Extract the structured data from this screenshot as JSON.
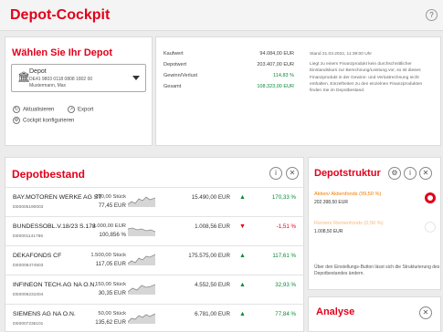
{
  "header": {
    "title": "Depot-Cockpit",
    "help_label": "?"
  },
  "selector": {
    "heading": "Wählen Sie Ihr Depot",
    "depot_name": "Depot",
    "depot_number": "DE41 9803 0118 0808 1802 00",
    "depot_owner": "Mustermann, Max",
    "actions": [
      {
        "label": "Aktualisieren",
        "icon": "refresh-icon",
        "glyph": "↻"
      },
      {
        "label": "Export",
        "icon": "export-icon",
        "glyph": "↗"
      },
      {
        "label": "Cockpit konfigurieren",
        "icon": "gear-icon",
        "glyph": "⚙"
      }
    ]
  },
  "summary": {
    "rows": [
      {
        "label": "Kaufwert",
        "value": "94.084,00 EUR"
      },
      {
        "label": "Depotwert",
        "value": "203.407,00 EUR"
      },
      {
        "label": "Gewinn/Verlust",
        "value": "114,83 %"
      },
      {
        "label": "Gesamt",
        "value": "108.323,00 EUR"
      }
    ],
    "info_date": "Stand 21.03.2022, 11:39:00 Uhr",
    "info_text": "Liegt zu einem Finanzprodukt kein durchschnittlicher Einstandskurs zur Berechnung/Leistung vor, so ist dieses Finanzprodukt in der Gewinn- und Verlustrechnung nicht enthalten. Einzelheiten zu den einzelnen Finanzprodukten finden Sie im Depotbestand."
  },
  "bestand": {
    "heading": "Depotbestand",
    "rows": [
      {
        "name": "BAY.MOTOREN WERKE AG ST",
        "isin": "DE0005190003",
        "qty": "200,00 Stück",
        "price": "77,45 EUR",
        "value": "15.490,00 EUR",
        "trend": "▲",
        "perf": "170,33 %",
        "dir": "pos"
      },
      {
        "name": "BUNDESSOBL.V.18/23 S.178",
        "isin": "DE0001141786",
        "qty": "1.000,00 EUR",
        "price": "100,856 %",
        "value": "1.008,56 EUR",
        "trend": "▼",
        "perf": "-1,51 %",
        "dir": "neg"
      },
      {
        "name": "DEKAFONDS CF",
        "isin": "DE0008474503",
        "qty": "1.500,00 Stück",
        "price": "117,05 EUR",
        "value": "175.575,00 EUR",
        "trend": "▲",
        "perf": "117,61 %",
        "dir": "pos"
      },
      {
        "name": "INFINEON TECH.AG NA O.N.",
        "isin": "DE0006231004",
        "qty": "150,00 Stück",
        "price": "30,35 EUR",
        "value": "4.552,50 EUR",
        "trend": "▲",
        "perf": "32,93 %",
        "dir": "pos"
      },
      {
        "name": "SIEMENS AG NA O.N.",
        "isin": "DE0007236101",
        "qty": "50,00 Stück",
        "price": "135,62 EUR",
        "value": "6.781,00 EUR",
        "trend": "▲",
        "perf": "77,84 %",
        "dir": "pos"
      }
    ]
  },
  "struktur": {
    "heading": "Depotstruktur",
    "items": [
      {
        "name": "Aktien/ Aktienfonds (99,50 %)",
        "amount": "202.398,50 EUR"
      },
      {
        "name": "Renten/ Rentenfonds (0,50 %)",
        "amount": "1.008,50 EUR"
      }
    ],
    "note": "Über den Einstellungs-Button lässt sich die Strukturierung des Depotbestandes ändern."
  },
  "analyse": {
    "heading": "Analyse"
  },
  "colors": {
    "brand": "#e2001a",
    "positive": "#0c8a3a",
    "orange": "#f07d00"
  }
}
